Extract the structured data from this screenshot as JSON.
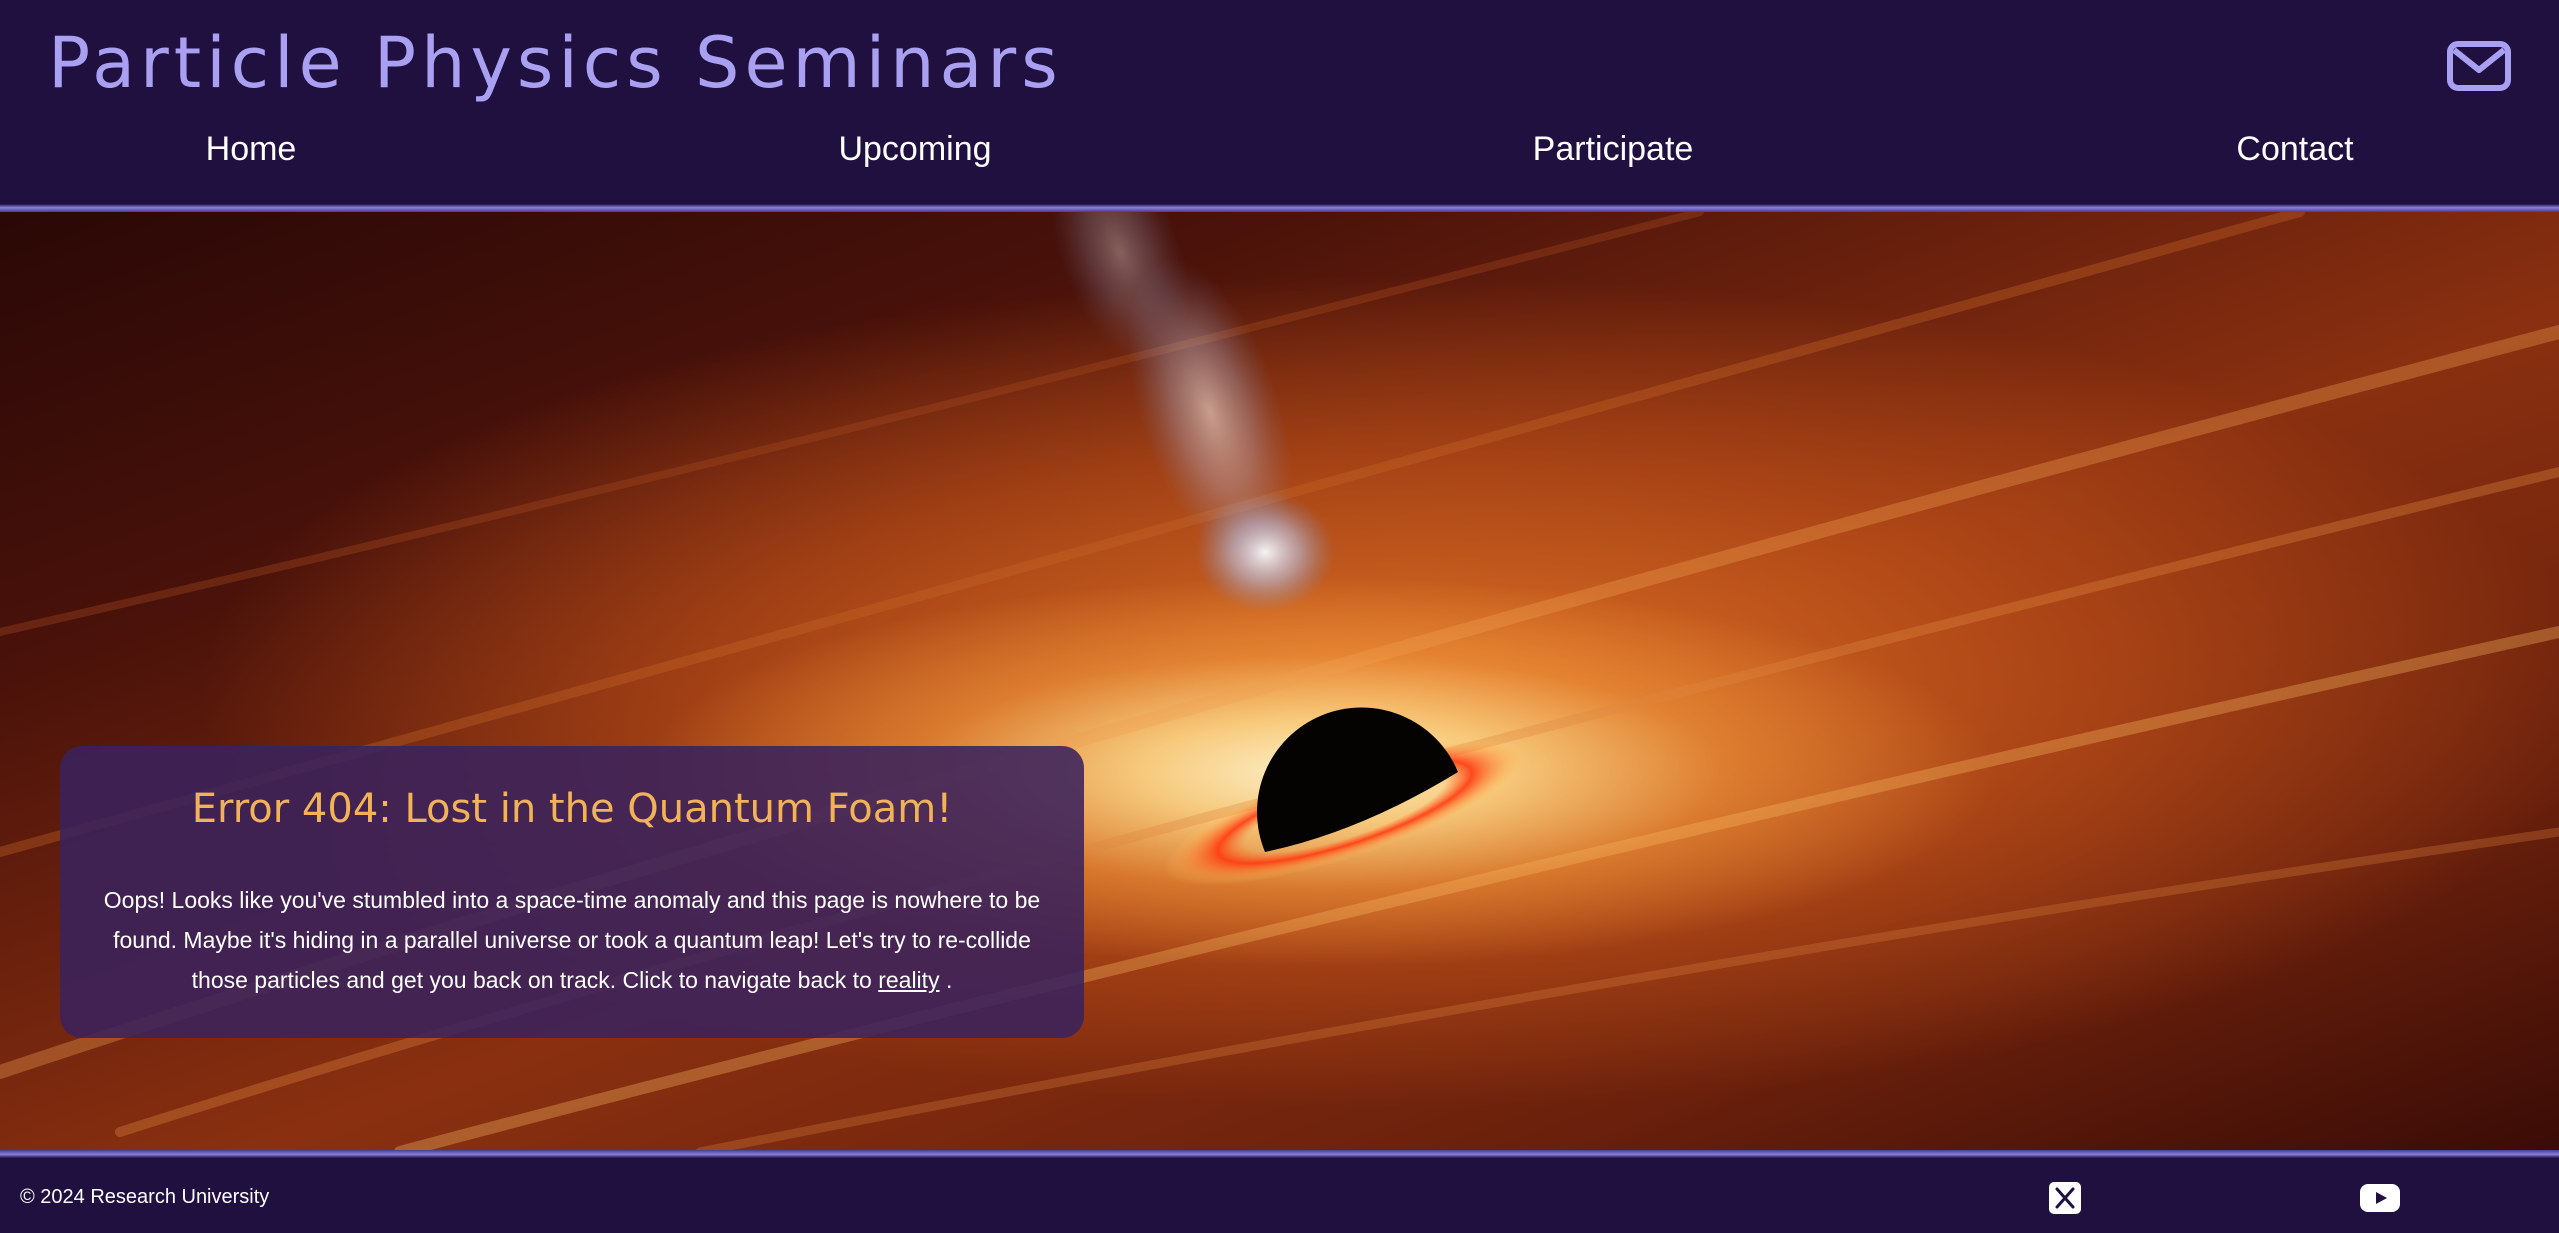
{
  "header": {
    "title": "Particle Physics Seminars",
    "mail_icon": "envelope-icon"
  },
  "nav": {
    "items": [
      {
        "label": "Home"
      },
      {
        "label": "Upcoming"
      },
      {
        "label": "Participate"
      },
      {
        "label": "Contact"
      }
    ]
  },
  "error": {
    "title": "Error 404: Lost in the Quantum Foam!",
    "message": "Oops! Looks like you've stumbled into a space-time anomaly and this page is nowhere to be found. Maybe it's hiding in a parallel universe or took a quantum leap! Let's try to re-collide those particles and get you back on track. Click to navigate back to",
    "link_label": "reality",
    "trailing": " ."
  },
  "footer": {
    "copyright": "© 2024 Research University",
    "social_icons": [
      "x-icon",
      "youtube-icon"
    ]
  },
  "colors": {
    "header_bg": "#1f1040",
    "title": "#a9a0f2",
    "error_title": "#f2b257",
    "card_bg": "#3a225c"
  }
}
